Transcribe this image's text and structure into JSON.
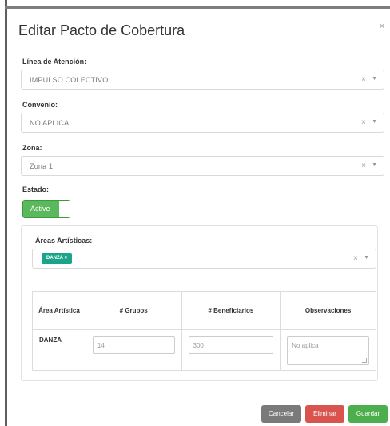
{
  "dialog": {
    "title": "Editar Pacto de Cobertura",
    "close_label": "×"
  },
  "form": {
    "linea": {
      "label": "Línea de Atención:",
      "value": "IMPULSO COLECTIVO"
    },
    "convenio": {
      "label": "Convenio:",
      "value": "NO APLICA"
    },
    "zona": {
      "label": "Zona:",
      "value": "Zona 1"
    },
    "estado": {
      "label": "Estado:",
      "toggle_label": "Active"
    },
    "areas": {
      "label": "Áreas Artísticas:",
      "tags": [
        "DANZA"
      ]
    },
    "select_clear": "×",
    "select_caret": "▼",
    "tag_remove": "×"
  },
  "table": {
    "headers": [
      "Área Artística",
      "# Grupos",
      "# Beneficiarios",
      "Observaciones"
    ],
    "rows": [
      {
        "area": "DANZA",
        "grupos": "14",
        "beneficiarios": "300",
        "observaciones": "No aplica"
      }
    ]
  },
  "footer": {
    "cancel_label": "Cancelar",
    "delete_label": "Eliminar",
    "save_label": "Guardar"
  },
  "colors": {
    "toggle_on": "#5cb85c",
    "tag": "#1aa58a",
    "cancel": "#7a7a7a",
    "delete": "#d9534f",
    "save": "#4cae4c"
  }
}
